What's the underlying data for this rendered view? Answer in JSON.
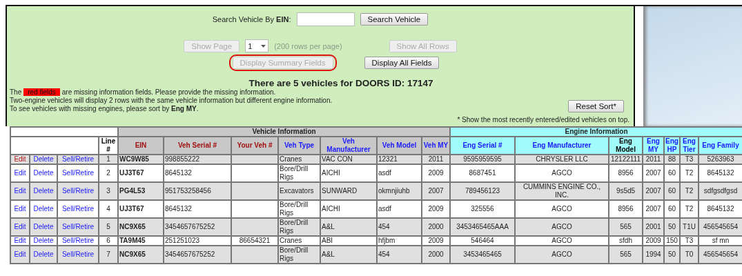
{
  "search": {
    "label": "Search Vehicle By **EIN**:",
    "button": "Search Vehicle"
  },
  "paging": {
    "show_page": {
      "label": "Show Page",
      "disabled": true
    },
    "page_select": "1",
    "rows_note": "(200 rows per page)",
    "show_all": {
      "label": "Show All Rows",
      "disabled": true
    }
  },
  "display_buttons": [
    {
      "label": "Display Summary Fields",
      "disabled": true,
      "circled": true
    },
    {
      "label": "Display All Fields",
      "disabled": false,
      "circled": false
    }
  ],
  "heading": "There are 5 vehicles for DOORS ID: 17147",
  "notes": {
    "first_before": "The",
    "red_tag": "red fields",
    "first_after": "are missing information fields. Please provide the missing information.",
    "lines": [
      "Two-engine vehicles will display 2 rows with the same vehicle information but different engine information.",
      "To see vehicles with missing engines, please sort by **Eng MY**."
    ]
  },
  "reset_button": "Reset Sort*",
  "reset_note": "* Show the most recently entered/edited vehicles on top.",
  "table": {
    "groups": [
      {
        "label": "Vehicle Information",
        "kind": "vehicle"
      },
      {
        "label": "Engine Information",
        "kind": "engine"
      }
    ],
    "columns": [
      {
        "label": "Line #",
        "kind": "plain",
        "color": "#000000"
      },
      {
        "label": "EIN",
        "kind": "vehicle",
        "color": "#a01010"
      },
      {
        "label": "Veh Serial #",
        "kind": "vehicle",
        "color": "#a01010"
      },
      {
        "label": "Your Veh #",
        "kind": "vehicle",
        "color": "#a01010"
      },
      {
        "label": "Veh Type",
        "kind": "vehicle",
        "color": "#1a1aff"
      },
      {
        "label": "Veh Manufacturer",
        "kind": "vehicle",
        "color": "#1a1aff"
      },
      {
        "label": "Veh Model",
        "kind": "vehicle",
        "color": "#1a1aff"
      },
      {
        "label": "Veh MY",
        "kind": "vehicle",
        "color": "#1a1aff"
      },
      {
        "label": "Eng Serial #",
        "kind": "engine",
        "color": "#1a1aff"
      },
      {
        "label": "Eng Manufacturer",
        "kind": "engine",
        "color": "#1a1aff"
      },
      {
        "label": "Eng Model",
        "kind": "engine",
        "color": "#000000"
      },
      {
        "label": "Eng MY",
        "kind": "engine",
        "color": "#1a1aff"
      },
      {
        "label": "Eng HP",
        "kind": "engine",
        "color": "#1a1aff"
      },
      {
        "label": "Eng Tier",
        "kind": "engine",
        "color": "#1a1aff"
      },
      {
        "label": "Eng Family",
        "kind": "engine",
        "color": "#1a1aff"
      }
    ],
    "rows": [
      {
        "actions": [
          "Edit",
          "Delete",
          "Sell/Retire"
        ],
        "missing_info": true,
        "cells": [
          "1",
          "WC9W85",
          "998855222",
          "",
          "Cranes",
          "VAC CON",
          "12321",
          "2011",
          "9595959595",
          "CHRYSLER LLC",
          "12122111",
          "2011",
          "88",
          "T3",
          "5263963"
        ]
      },
      {
        "actions": [
          "Edit",
          "Delete",
          "Sell/Retire"
        ],
        "missing_info": false,
        "cells": [
          "2",
          "UJ3T67",
          "8645132",
          "",
          "Bore/Drill Rigs",
          "AICHI",
          "asdf",
          "2009",
          "8687451",
          "AGCO",
          "8956",
          "2007",
          "60",
          "T2",
          "8645132"
        ]
      },
      {
        "actions": [
          "Edit",
          "Delete",
          "Sell/Retire"
        ],
        "missing_info": false,
        "cells": [
          "3",
          "PG4L53",
          "951753258456",
          "",
          "Excavators",
          "SUNWARD",
          "okmnjiuhb",
          "2007",
          "789456123",
          "CUMMINS ENGINE CO., INC.",
          "9s5d5",
          "2007",
          "60",
          "T2",
          "sdfgsdfgsd"
        ]
      },
      {
        "actions": [
          "Edit",
          "Delete",
          "Sell/Retire"
        ],
        "missing_info": false,
        "cells": [
          "4",
          "UJ3T67",
          "8645132",
          "",
          "Bore/Drill Rigs",
          "AICHI",
          "asdf",
          "2009",
          "325556",
          "AGCO",
          "8956",
          "2007",
          "60",
          "T2",
          "8645132"
        ]
      },
      {
        "actions": [
          "Edit",
          "Delete",
          "Sell/Retire"
        ],
        "missing_info": false,
        "cells": [
          "5",
          "NC9X65",
          "3454657675252",
          "",
          "Bore/Drill Rigs",
          "A&L",
          "454",
          "2000",
          "3453465465AAA",
          "AGCO",
          "565",
          "2001",
          "50",
          "T1U",
          "456545654"
        ]
      },
      {
        "actions": [
          "Edit",
          "Delete",
          "Sell/Retire"
        ],
        "missing_info": false,
        "cells": [
          "6",
          "TA9M45",
          "251251023",
          "86654321",
          "Cranes",
          "ABI",
          "hfjbm",
          "2009",
          "546464",
          "AGCO",
          "sfdh",
          "2009",
          "150",
          "T3",
          "sf mn"
        ]
      },
      {
        "actions": [
          "Edit",
          "Delete",
          "Sell/Retire"
        ],
        "missing_info": false,
        "cells": [
          "7",
          "NC9X65",
          "3454657675252",
          "",
          "Bore/Drill Rigs",
          "A&L",
          "454",
          "2000",
          "3453465465",
          "AGCO",
          "565",
          "1994",
          "50",
          "T0",
          "456545654"
        ]
      }
    ]
  }
}
